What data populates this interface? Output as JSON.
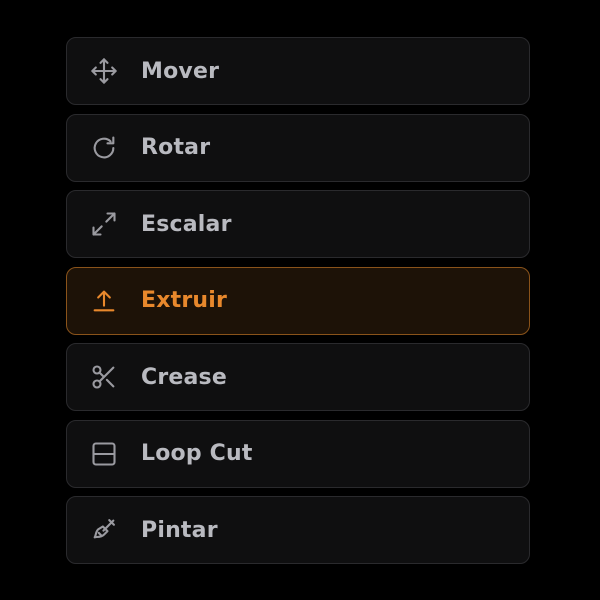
{
  "tools": [
    {
      "label": "Mover",
      "icon": "move-icon",
      "active": false
    },
    {
      "label": "Rotar",
      "icon": "rotate-icon",
      "active": false
    },
    {
      "label": "Escalar",
      "icon": "scale-icon",
      "active": false
    },
    {
      "label": "Extruir",
      "icon": "extrude-icon",
      "active": true
    },
    {
      "label": "Crease",
      "icon": "scissors-icon",
      "active": false
    },
    {
      "label": "Loop Cut",
      "icon": "loop-cut-icon",
      "active": false
    },
    {
      "label": "Pintar",
      "icon": "paint-brush-icon",
      "active": false
    }
  ],
  "colors": {
    "background": "#000000",
    "item_background": "#0f0f10",
    "item_border": "#2a2a2d",
    "text": "#b9bac0",
    "icon": "#9a9aa0",
    "accent": "#e8882c",
    "active_background": "#1d1207",
    "active_border": "#8a531a"
  }
}
